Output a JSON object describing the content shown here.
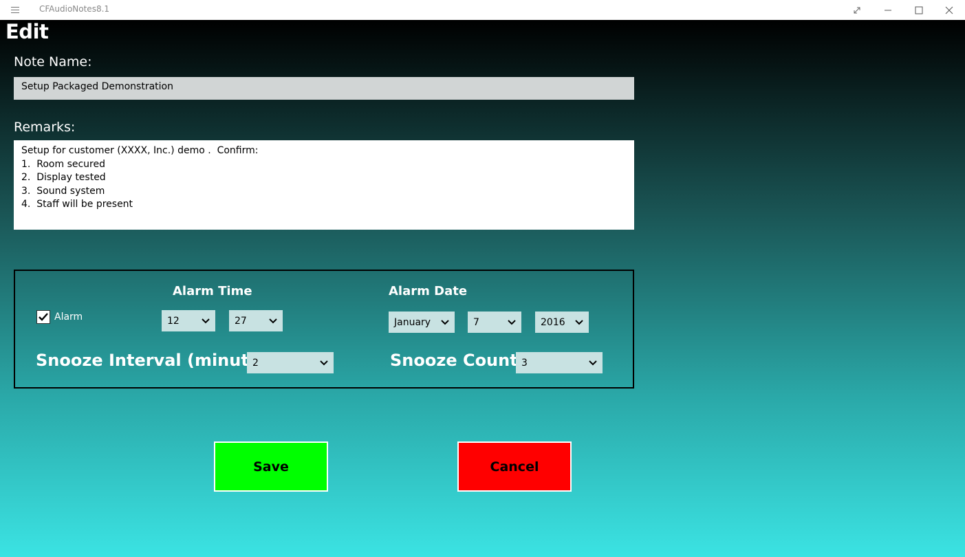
{
  "window": {
    "app_title": "CFAudioNotes8.1",
    "menu_icon": "hamburger-icon",
    "controls": [
      "expand-icon",
      "minimize-icon",
      "maximize-icon",
      "close-icon"
    ]
  },
  "page": {
    "heading": "Edit"
  },
  "note_name": {
    "label": "Note Name:",
    "value": "Setup Packaged Demonstration"
  },
  "remarks": {
    "label": "Remarks:",
    "lines": [
      "Setup for customer (XXXX, Inc.) demo .  Confirm:",
      "1.  Room secured",
      "2.  Display tested",
      "3.  Sound system",
      "4.  Staff will be present"
    ]
  },
  "alarm": {
    "checkbox_label": "Alarm",
    "checked": true,
    "time_heading": "Alarm Time",
    "hour": "12",
    "minute": "27",
    "date_heading": "Alarm Date",
    "month": "January",
    "day": "7",
    "year": "2016",
    "snooze_interval_label": "Snooze Interval (minutes)",
    "snooze_interval": "2",
    "snooze_count_label": "Snooze Count",
    "snooze_count": "3"
  },
  "buttons": {
    "save_label": "Save",
    "cancel_label": "Cancel"
  },
  "colors": {
    "save_bg": "#00ff00",
    "cancel_bg": "#ff0000",
    "gradient_top": "#000000",
    "gradient_bottom": "#3be3e3"
  }
}
